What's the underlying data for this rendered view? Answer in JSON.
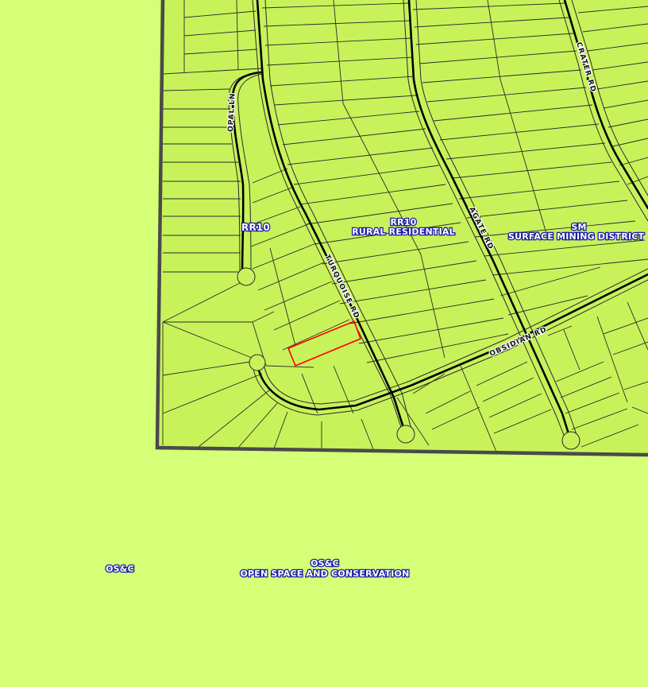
{
  "colors": {
    "background": "#d4ff77",
    "zoned_area": "#c8f25a",
    "lot_lines": "#2b2b2b",
    "road_centerline": "#000000",
    "boundary": "#4a4a4a",
    "highlight_parcel": "#ff0000",
    "label_text": "#ffffff",
    "label_outline": "#1a1aa6"
  },
  "zones": {
    "rr10_short": "RR10",
    "rr10_code": "RR10",
    "rr10_name": "RURAL RESIDENTIAL",
    "sm_code": "SM",
    "sm_name": "SURFACE MINING DISTRICT",
    "osc_short": "OS&C",
    "osc_code": "OS&C",
    "osc_name": "OPEN SPACE AND CONSERVATION"
  },
  "roads": {
    "opal": "OPAL LN",
    "turquoise": "TURQUOISE RD",
    "agate": "AGATE RD",
    "crater": "CRATER RD",
    "obsidian": "OBSIDIAN RD"
  }
}
